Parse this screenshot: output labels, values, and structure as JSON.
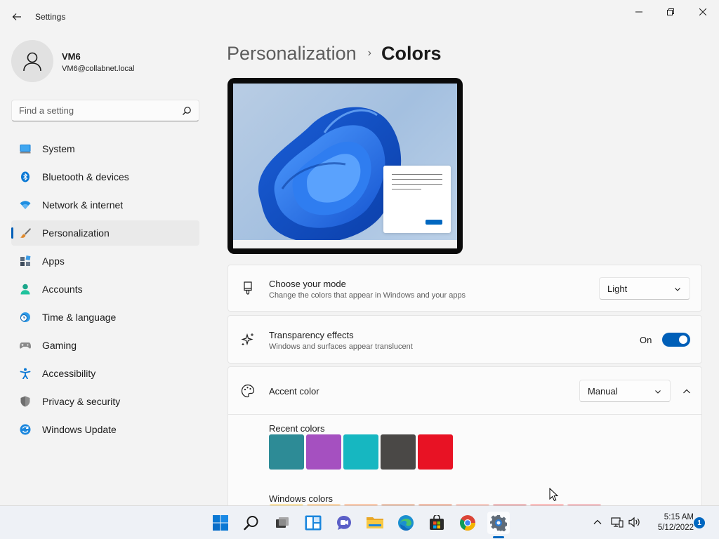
{
  "window": {
    "title": "Settings"
  },
  "profile": {
    "name": "VM6",
    "email": "VM6@collabnet.local"
  },
  "search": {
    "placeholder": "Find a setting"
  },
  "sidebar": {
    "items": [
      {
        "label": "System",
        "icon": "monitor-icon",
        "selected": false
      },
      {
        "label": "Bluetooth & devices",
        "icon": "bluetooth-icon",
        "selected": false
      },
      {
        "label": "Network & internet",
        "icon": "wifi-icon",
        "selected": false
      },
      {
        "label": "Personalization",
        "icon": "brush-icon",
        "selected": true
      },
      {
        "label": "Apps",
        "icon": "apps-icon",
        "selected": false
      },
      {
        "label": "Accounts",
        "icon": "person-icon",
        "selected": false
      },
      {
        "label": "Time & language",
        "icon": "clock-globe-icon",
        "selected": false
      },
      {
        "label": "Gaming",
        "icon": "gamepad-icon",
        "selected": false
      },
      {
        "label": "Accessibility",
        "icon": "accessibility-icon",
        "selected": false
      },
      {
        "label": "Privacy & security",
        "icon": "shield-icon",
        "selected": false
      },
      {
        "label": "Windows Update",
        "icon": "update-icon",
        "selected": false
      }
    ]
  },
  "breadcrumb": {
    "parent": "Personalization",
    "separator": "›",
    "current": "Colors"
  },
  "mode_card": {
    "title": "Choose your mode",
    "subtitle": "Change the colors that appear in Windows and your apps",
    "value": "Light"
  },
  "transparency_card": {
    "title": "Transparency effects",
    "subtitle": "Windows and surfaces appear translucent",
    "toggle_label": "On",
    "toggle_on": true
  },
  "accent_card": {
    "title": "Accent color",
    "value": "Manual",
    "recent_label": "Recent colors",
    "recent_colors": [
      "#2d8b96",
      "#a550c0",
      "#16b7c1",
      "#4a4846",
      "#e81224"
    ],
    "windows_label": "Windows colors",
    "windows_colors": [
      "#ffb900",
      "#ff8c00",
      "#f7630c",
      "#ca5010",
      "#da3b01",
      "#ef6950",
      "#d13438",
      "#ff4343",
      "#e74856"
    ]
  },
  "theme": {
    "accent": "#005fb8",
    "background": "#f3f3f3",
    "card": "#fbfbfb"
  },
  "taskbar": {
    "apps": [
      "start-icon",
      "search-icon",
      "task-view-icon",
      "widgets-icon",
      "chat-icon",
      "file-explorer-icon",
      "edge-icon",
      "store-icon",
      "chrome-icon",
      "settings-icon"
    ],
    "time": "5:15 AM",
    "date": "5/12/2022",
    "notifications": "1"
  }
}
